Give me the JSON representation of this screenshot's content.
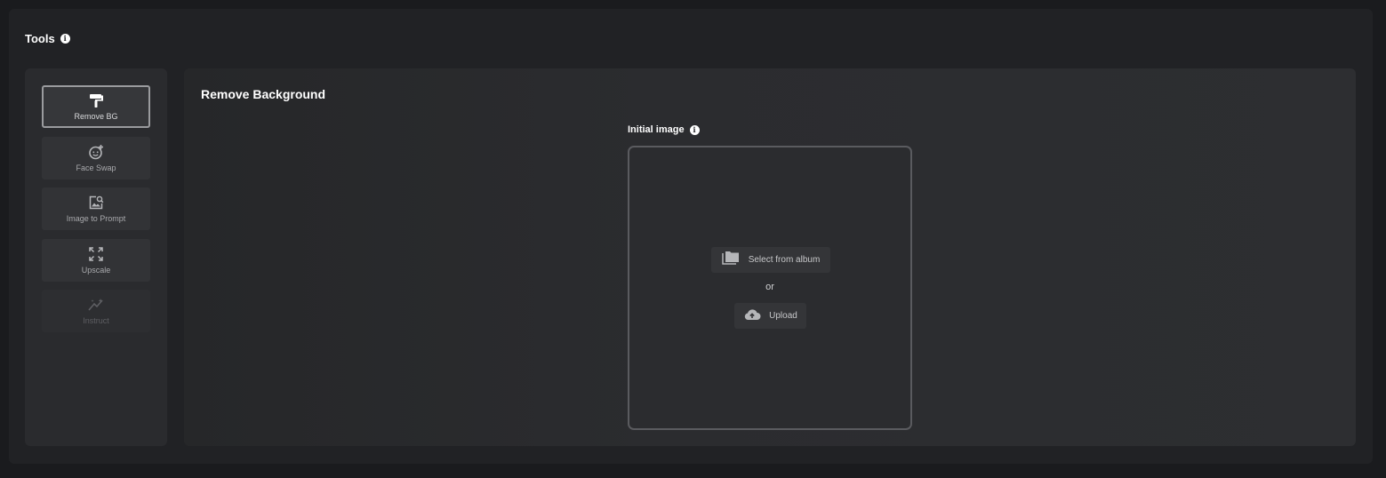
{
  "header": {
    "title": "Tools",
    "info_glyph": "i"
  },
  "sidebar": {
    "items": [
      {
        "label": "Remove BG",
        "icon": "paint-roller-icon",
        "state": "active"
      },
      {
        "label": "Face Swap",
        "icon": "face-add-icon",
        "state": "normal"
      },
      {
        "label": "Image to Prompt",
        "icon": "image-search-icon",
        "state": "normal"
      },
      {
        "label": "Upscale",
        "icon": "expand-arrows-icon",
        "state": "normal"
      },
      {
        "label": "Instruct",
        "icon": "sparkle-wand-icon",
        "state": "disabled"
      }
    ]
  },
  "main": {
    "title": "Remove Background",
    "initial_image": {
      "label": "Initial image",
      "info_glyph": "i",
      "select_label": "Select from album",
      "select_icon": "folder-stack-icon",
      "or_text": "or",
      "upload_label": "Upload",
      "upload_icon": "cloud-upload-icon"
    }
  },
  "colors": {
    "background": "#1a1b1e",
    "panel": "#212225",
    "active_border": "#9a9b9e",
    "text_primary": "#ffffff"
  }
}
